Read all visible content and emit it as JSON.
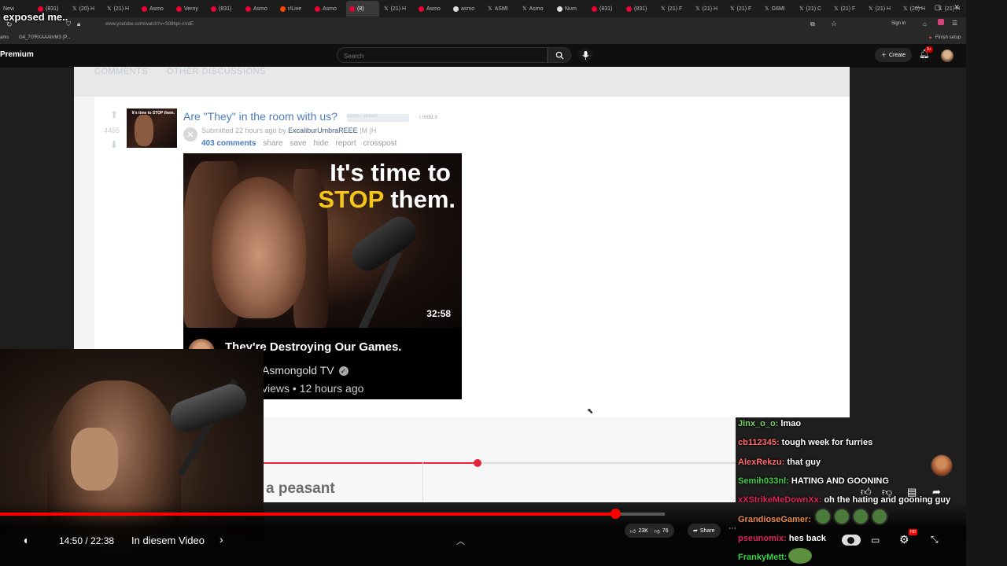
{
  "browser": {
    "tabs": [
      {
        "label": "New",
        "icon": "text"
      },
      {
        "label": "(831)",
        "icon": "youtube-icon"
      },
      {
        "label": "(20) H",
        "icon": "x-icon"
      },
      {
        "label": "(21) H",
        "icon": "x-icon"
      },
      {
        "label": "Asmo",
        "icon": "youtube-icon"
      },
      {
        "label": "Verny",
        "icon": "youtube-icon"
      },
      {
        "label": "(831)",
        "icon": "youtube-icon"
      },
      {
        "label": "Asmo",
        "icon": "youtube-icon"
      },
      {
        "label": "r/Live",
        "icon": "reddit-icon"
      },
      {
        "label": "Asmo",
        "icon": "youtube-icon"
      },
      {
        "label": "(8)",
        "icon": "youtube-icon",
        "active": true
      },
      {
        "label": "(21) H",
        "icon": "x-icon"
      },
      {
        "label": "Asmo",
        "icon": "youtube-icon"
      },
      {
        "label": "asmo",
        "icon": "google-icon"
      },
      {
        "label": "ASMI",
        "icon": "x-icon"
      },
      {
        "label": "Asmo",
        "icon": "x-icon"
      },
      {
        "label": "Num",
        "icon": "google-icon"
      },
      {
        "label": "(831)",
        "icon": "youtube-icon"
      },
      {
        "label": "(831)",
        "icon": "youtube-icon"
      },
      {
        "label": "(21) F",
        "icon": "x-icon"
      },
      {
        "label": "(21) H",
        "icon": "x-icon"
      },
      {
        "label": "(21) F",
        "icon": "x-icon"
      },
      {
        "label": "G6MI",
        "icon": "x-icon"
      },
      {
        "label": "(21) C",
        "icon": "x-icon"
      },
      {
        "label": "(21) F",
        "icon": "x-icon"
      },
      {
        "label": "(21) H",
        "icon": "x-icon"
      },
      {
        "label": "(20) H",
        "icon": "x-icon"
      },
      {
        "label": "(21) H",
        "icon": "x-icon"
      },
      {
        "label": "(20",
        "icon": "x-icon"
      }
    ],
    "new_tab": "+",
    "url": "www.youtube.com/watch?v=S08hpr-nVdE",
    "bookmarks_left": "arks",
    "bookmark_item": "G4_7t7RXAAAhrM3 (P...",
    "sign_in": "Sign in",
    "finish_setup": "Finish setup",
    "window_controls": [
      "—",
      "▢",
      "✕"
    ]
  },
  "stream_title": "exposed me..",
  "youtube": {
    "logo": "Premium",
    "search_placeholder": "Search",
    "create_label": "Create",
    "notif_count": "9+"
  },
  "reddit": {
    "tabs": [
      "COMMENTS",
      "OTHER DISCUSSIONS"
    ],
    "score": "4465",
    "thumb_text": "It's time to STOP them.",
    "title": "Are \"They\" in the room with us?",
    "flair": "clutch / stream",
    "domain": "i.redd.it",
    "submitted_prefix": "Submitted 22 hours ago by",
    "author": "ExcaliburUmbraREEE",
    "author_suffix": "|M |H",
    "actions": [
      "403 comments",
      "share",
      "save",
      "hide",
      "report",
      "crosspost"
    ]
  },
  "video_card": {
    "thumb_line1": "It's time to",
    "thumb_stop": "STOP",
    "thumb_them": " them.",
    "duration": "32:58",
    "title": "They're Destroying Our Games.",
    "channel": "Asmongold TV",
    "meta": "views • 12 hours ago"
  },
  "inner_player": {
    "text": "a peasant",
    "progress_fraction": 0.453
  },
  "player": {
    "current_time": "14:50",
    "duration": "22:38",
    "chapter": "In diesem Video",
    "progress_fraction": 0.925,
    "likes": "23K",
    "dislikes": "76",
    "share_label": "Share",
    "hd_badge": "HD"
  },
  "chat": [
    {
      "user": "Jinx_o_o:",
      "msg": "lmao",
      "color": "#7fd36b"
    },
    {
      "user": "cb112345:",
      "msg": "tough week for furries",
      "color": "#ff6b6b"
    },
    {
      "user": "AlexRekzu:",
      "msg": "that guy",
      "color": "#ff6b6b"
    },
    {
      "user": "Semih033nl:",
      "msg": "HATING AND GOONING",
      "color": "#3fd04a"
    },
    {
      "user": "xXStrikeMeDownXx:",
      "msg": "oh the hating and gooning guy",
      "color": "#e0245e"
    },
    {
      "user": "GrandioseGamer:",
      "msg": "",
      "color": "#e88a50"
    },
    {
      "user": "pseunomix:",
      "msg": "hes back",
      "color": "#e0245e"
    },
    {
      "user": "FrankyMett:",
      "msg": "",
      "color": "#3fd04a"
    }
  ],
  "colors": {
    "youtube_red": "#ff0000",
    "reddit_link": "#4a7bbf",
    "thumb_accent": "#f5c51a"
  }
}
